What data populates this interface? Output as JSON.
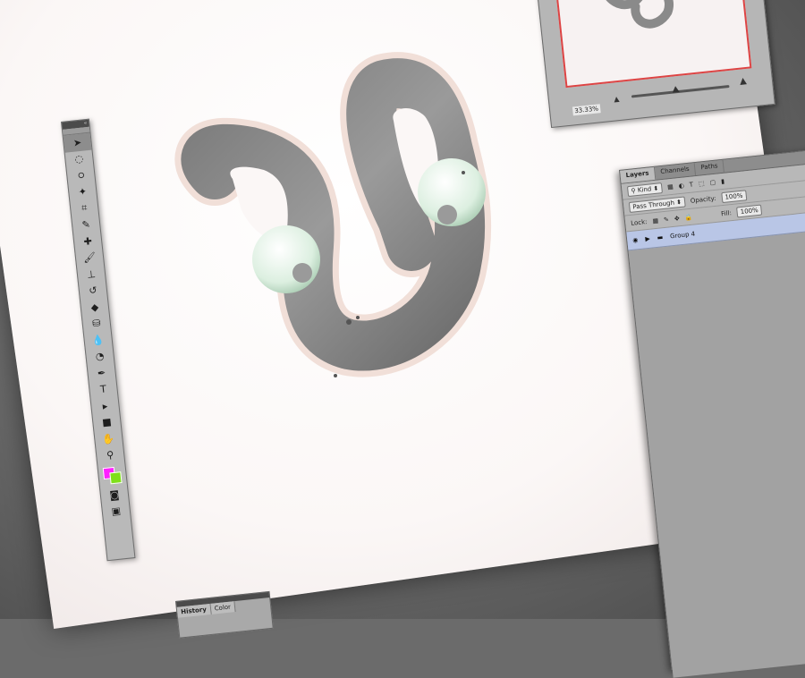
{
  "tools_panel": {
    "title": "«",
    "tools": [
      {
        "name": "move-tool",
        "glyph": "➤",
        "active": true
      },
      {
        "name": "marquee-tool",
        "glyph": "◌"
      },
      {
        "name": "lasso-tool",
        "glyph": "ഠ"
      },
      {
        "name": "magic-wand-tool",
        "glyph": "✦"
      },
      {
        "name": "crop-tool",
        "glyph": "⌗"
      },
      {
        "name": "eyedropper-tool",
        "glyph": "✎"
      },
      {
        "name": "healing-brush-tool",
        "glyph": "✚"
      },
      {
        "name": "brush-tool",
        "glyph": "🖌"
      },
      {
        "name": "clone-stamp-tool",
        "glyph": "⊥"
      },
      {
        "name": "history-brush-tool",
        "glyph": "↺"
      },
      {
        "name": "eraser-tool",
        "glyph": "◆"
      },
      {
        "name": "paint-bucket-tool",
        "glyph": "⛁"
      },
      {
        "name": "blur-tool",
        "glyph": "💧"
      },
      {
        "name": "dodge-tool",
        "glyph": "◔"
      },
      {
        "name": "pen-tool",
        "glyph": "✒"
      },
      {
        "name": "type-tool",
        "glyph": "T"
      },
      {
        "name": "path-selection-tool",
        "glyph": "▸"
      },
      {
        "name": "rectangle-tool",
        "glyph": "■"
      },
      {
        "name": "hand-tool",
        "glyph": "✋"
      },
      {
        "name": "zoom-tool",
        "glyph": "⚲"
      }
    ],
    "foreground_color": "#ff20ff",
    "background_color": "#7fe01a"
  },
  "navigator": {
    "zoom": "33.33%"
  },
  "layers_panel": {
    "tabs": [
      "Layers",
      "Channels",
      "Paths"
    ],
    "active_tab": "Layers",
    "filter_kind": "Kind",
    "blend_mode": "Pass Through",
    "opacity_label": "Opacity:",
    "opacity_value": "100%",
    "lock_label": "Lock:",
    "fill_label": "Fill:",
    "fill_value": "100%",
    "layers": [
      {
        "name": "Group 4",
        "type": "group",
        "visible": true,
        "selected": true
      }
    ]
  },
  "history_panel": {
    "tabs": [
      "History",
      "Color"
    ],
    "active_tab": "History"
  },
  "colors": {
    "accent": "#d44444",
    "selection": "#b9c6e6"
  }
}
